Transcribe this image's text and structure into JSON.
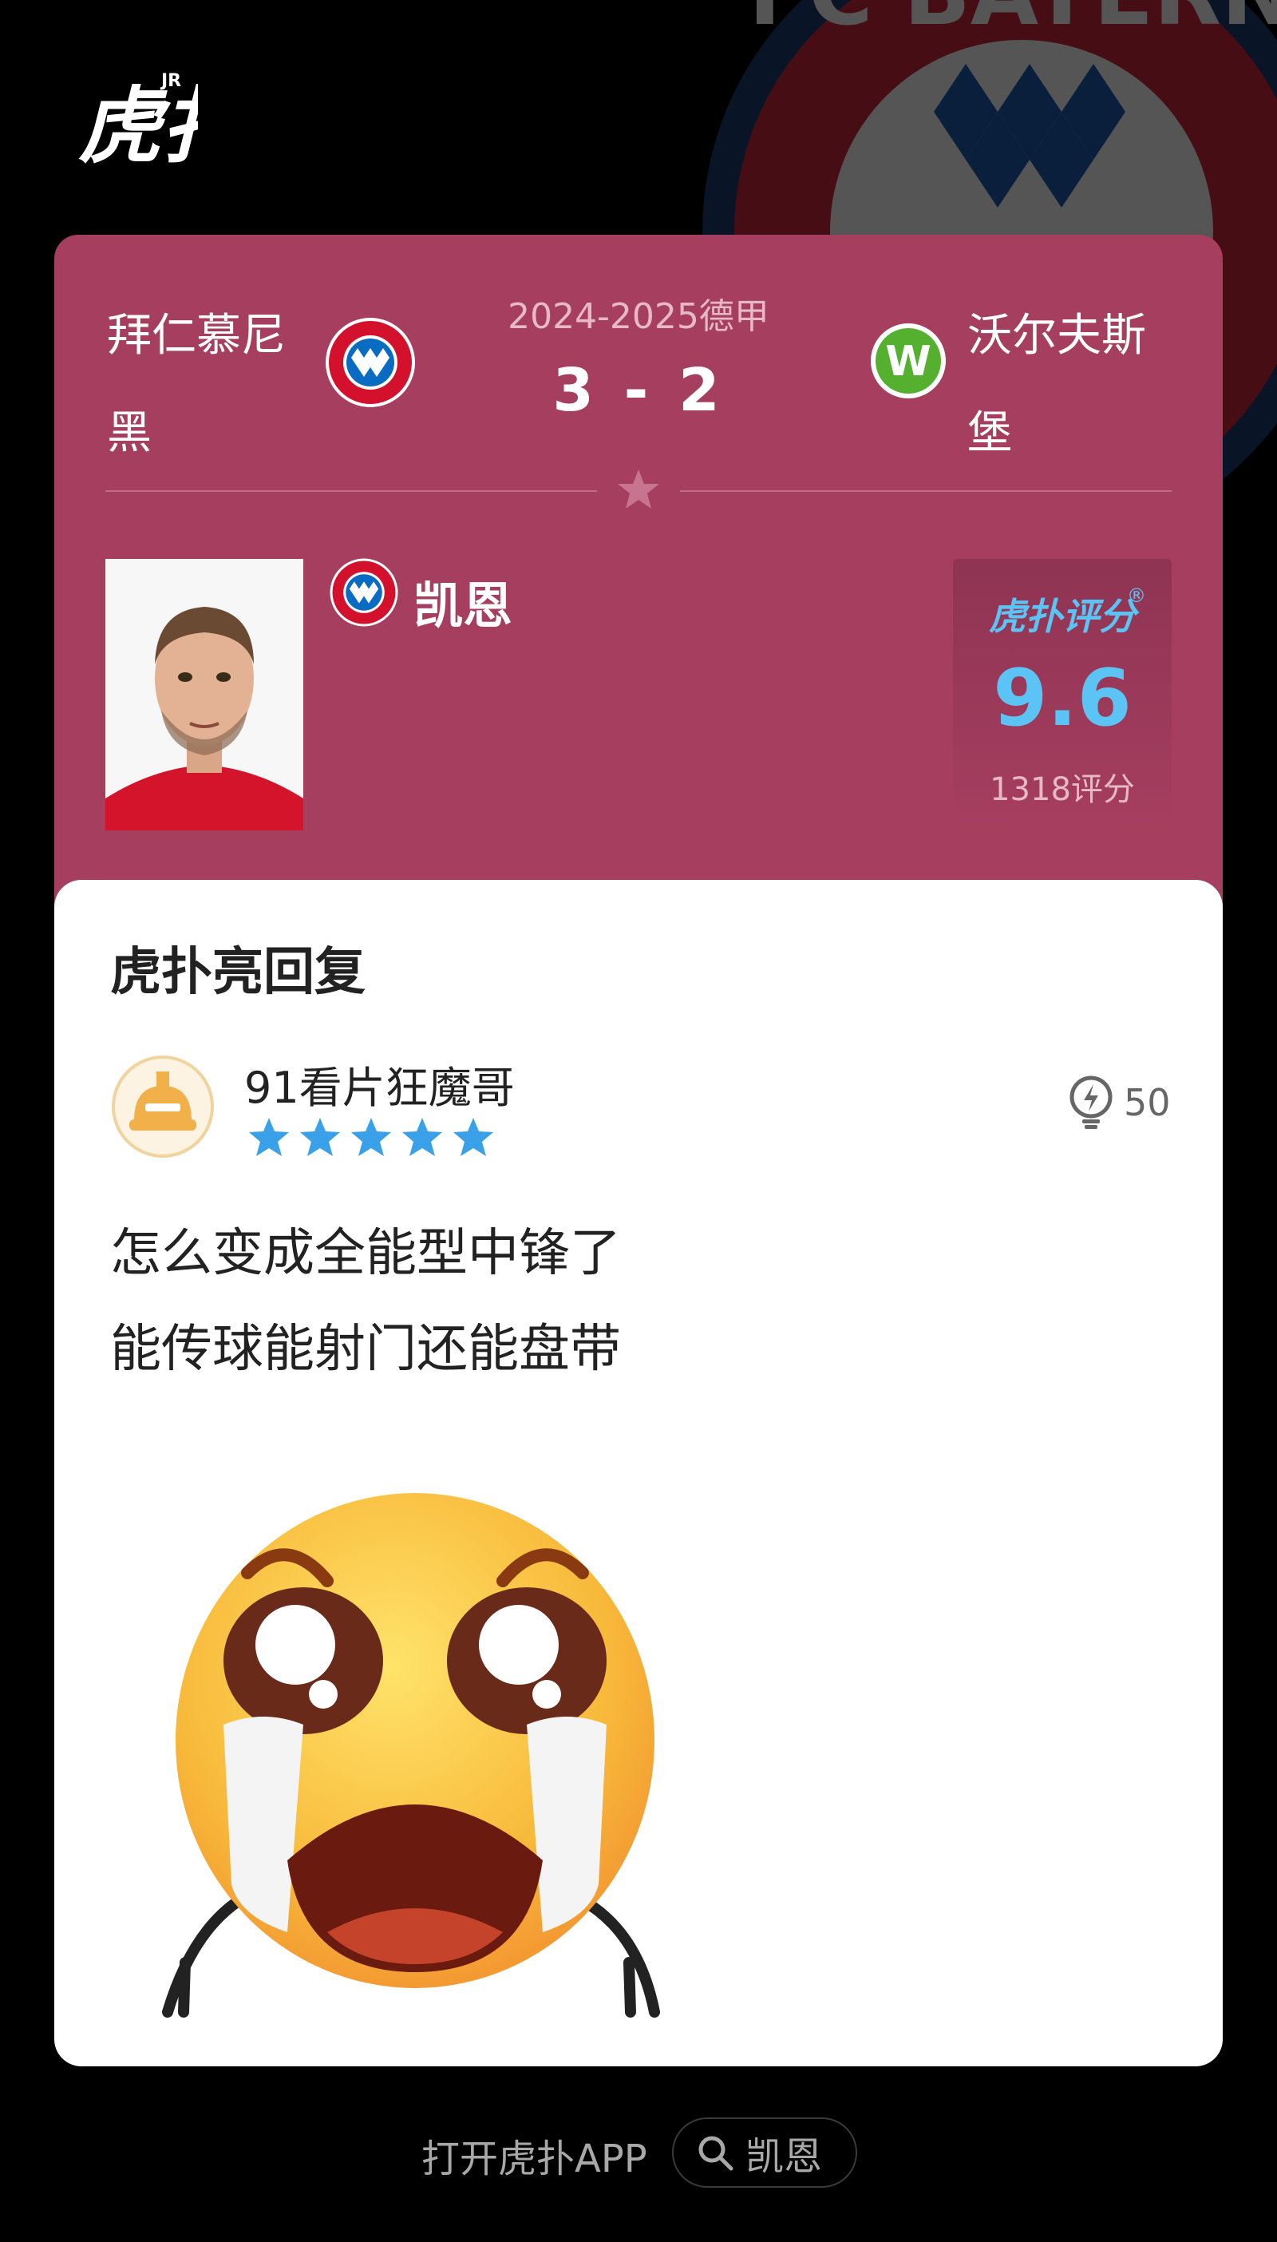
{
  "brand": {
    "logo_text": "虎扑",
    "logo_sup": "JR"
  },
  "background_crest_text": "FC BAYERN",
  "match": {
    "league": "2024-2025德甲",
    "score": "3 - 2",
    "home_team": "拜仁慕尼黑",
    "away_team": "沃尔夫斯堡",
    "home_crest_text": "FC BAYERN MÜNCHEN",
    "away_crest_letter": "W"
  },
  "player": {
    "name": "凯恩"
  },
  "rating": {
    "brand": "虎扑评分",
    "registered_mark": "®",
    "value": "9.6",
    "count": "1318评分"
  },
  "reply": {
    "heading": "虎扑亮回复",
    "username": "91看片狂魔哥",
    "stars": 5,
    "likes": "50",
    "comment_lines": [
      "怎么变成全能型中锋了",
      "能传球能射门还能盘带"
    ]
  },
  "footer": {
    "open_app": "打开虎扑APP",
    "search_term": "凯恩"
  },
  "colors": {
    "card": "#a63e60",
    "rating_accent": "#5cc4f4",
    "star": "#3aa0e8"
  }
}
